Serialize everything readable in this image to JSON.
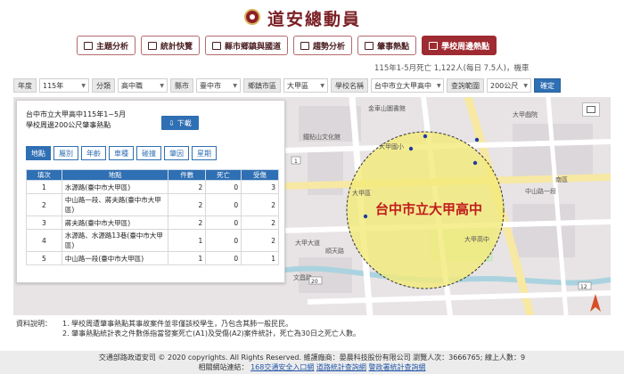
{
  "site": {
    "title": "道安總動員"
  },
  "nav": [
    {
      "label": "主題分析",
      "icon": "chart-icon",
      "active": false
    },
    {
      "label": "統計快覽",
      "icon": "list-icon",
      "active": false
    },
    {
      "label": "縣市鄉鎮與國道",
      "icon": "map-icon",
      "active": false
    },
    {
      "label": "趨勢分析",
      "icon": "trend-icon",
      "active": false
    },
    {
      "label": "肇事熱點",
      "icon": "pin-icon",
      "active": false
    },
    {
      "label": "學校周邊熱點",
      "icon": "school-icon",
      "active": true
    }
  ],
  "ticker": "115年1-5月死亡 1,122人(每日 7.5人)，機車",
  "filters": {
    "year_label": "年度",
    "year_value": "115年",
    "category_label": "分類",
    "category_value": "高中職",
    "city_label": "縣市",
    "city_value": "臺中市",
    "district_label": "鄉鎮市區",
    "district_value": "大甲區",
    "school_label": "學校名稱",
    "school_value": "台中市立大甲高中",
    "range_label": "查詢範圍",
    "range_value": "200公尺",
    "confirm_label": "確定"
  },
  "panel": {
    "title_line1": "台中市立大甲高中115年1~5月",
    "title_line2": "學校周邊200公尺肇事熱點",
    "download_label": "下載",
    "tabs": [
      "地點",
      "屬別",
      "年齡",
      "車種",
      "碰撞",
      "肇因",
      "星期"
    ],
    "active_tab": "地點",
    "table": {
      "headers": [
        "填次",
        "地點",
        "件數",
        "死亡",
        "受傷"
      ],
      "rows": [
        [
          "1",
          "水源路(臺中市大甲區)",
          "2",
          "0",
          "3"
        ],
        [
          "2",
          "中山路一段、蔣夫路(臺中市大甲區)",
          "2",
          "0",
          "2"
        ],
        [
          "3",
          "蔣夫路(臺中市大甲區)",
          "2",
          "0",
          "2"
        ],
        [
          "4",
          "水源路、水源路13巷(臺中市大甲區)",
          "1",
          "0",
          "2"
        ],
        [
          "5",
          "中山路一段(臺中市大甲區)",
          "1",
          "0",
          "1"
        ]
      ]
    }
  },
  "map": {
    "school_label": "台中市立大甲高中",
    "place_labels": [
      "金車山圖書館",
      "鐵鉆山文化館",
      "大甲國小",
      "大甲戲院",
      "大甲區",
      "大甲高中",
      "南區",
      "中山路一段",
      "文昌路",
      "順天路",
      "大甲大道"
    ],
    "road_numbers": [
      "1",
      "12",
      "20"
    ],
    "fill_color": "#f3ea7a",
    "stroke_color": "#333333"
  },
  "notes": {
    "label": "資料說明：",
    "items": [
      "1. 學校周遭肇事熱點其事故案件並非僅該校學生，乃包含其肺一般民民。",
      "2. 肇事熱點統計表之件數係指當發案死亡(A1)及受傷(A2)案件統計，死亡為30日之死亡人數。"
    ]
  },
  "footer": {
    "line1": "交通部路政道安司 © 2020 copyrights. All Rights Reserved. 維護廠商：晏晨科技股份有限公司 瀏覽人次：3666765; 線上人數：9",
    "links_label": "相關網站連結：",
    "links": [
      "168交通安全入口網",
      "道路統計查詢網",
      "警政署統計查詢網"
    ]
  }
}
